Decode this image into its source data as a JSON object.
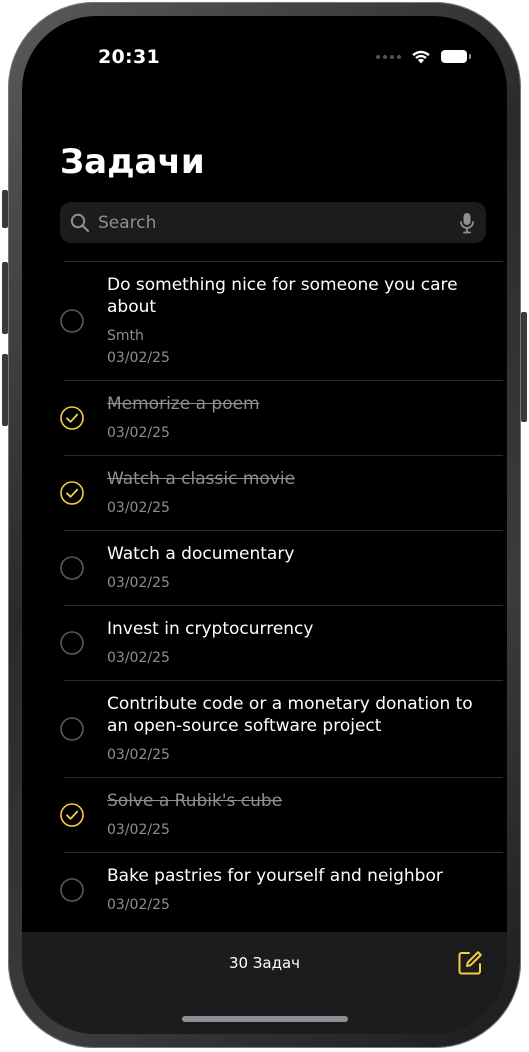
{
  "status_bar": {
    "time": "20:31"
  },
  "header": {
    "title": "Задачи"
  },
  "search": {
    "placeholder": "Search",
    "value": ""
  },
  "tasks": [
    {
      "title": "Do something nice for someone you care about",
      "description": "Smth",
      "date": "03/02/25",
      "completed": false
    },
    {
      "title": "Memorize a poem",
      "date": "03/02/25",
      "completed": true
    },
    {
      "title": "Watch a classic movie",
      "date": "03/02/25",
      "completed": true
    },
    {
      "title": "Watch a documentary",
      "date": "03/02/25",
      "completed": false
    },
    {
      "title": "Invest in cryptocurrency",
      "date": "03/02/25",
      "completed": false
    },
    {
      "title": "Contribute code or a monetary donation to an open-source software project",
      "date": "03/02/25",
      "completed": false
    },
    {
      "title": "Solve a Rubik's cube",
      "date": "03/02/25",
      "completed": true
    },
    {
      "title": "Bake pastries for yourself and neighbor",
      "date": "03/02/25",
      "completed": false
    }
  ],
  "toolbar": {
    "count_label": "30 Задач"
  },
  "colors": {
    "accent": "#F5CE3E",
    "background": "#000000",
    "secondary_text": "#8E8E93",
    "separator": "#2C2C2E"
  },
  "icons": {
    "search": "search-icon",
    "mic": "mic-icon",
    "compose": "compose-icon",
    "checked": "checkmark-circle-icon",
    "unchecked": "empty-circle-icon"
  }
}
